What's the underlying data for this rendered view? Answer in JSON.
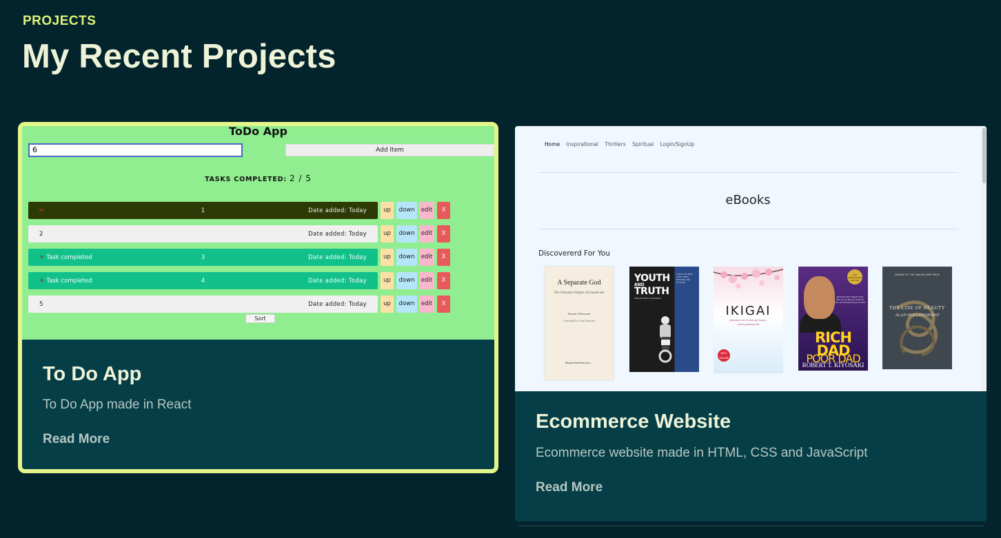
{
  "section": {
    "eyebrow": "PROJECTS",
    "title": "My Recent Projects"
  },
  "colors": {
    "background": "#03242c",
    "card": "#053e47",
    "accent": "#dff27a",
    "heading": "#eef3d8",
    "muted": "#b8c7c2"
  },
  "projects": [
    {
      "title": "To Do App",
      "description": "To Do App made in React",
      "link": "Read More",
      "selected": true,
      "preview": {
        "app_title": "ToDo App",
        "input_value": "6",
        "add_button": "Add Item",
        "tasks_completed_label": "TASKS COMPLETED:",
        "tasks_completed_count": "2 / 5",
        "rows": [
          {
            "lead": "",
            "number": "1",
            "date": "Date added: Today",
            "style": "dark"
          },
          {
            "lead": "2",
            "number": "",
            "date": "Date added: Today",
            "style": "light"
          },
          {
            "lead": "Task completed",
            "number": "3",
            "date": "Date added: Today",
            "style": "done"
          },
          {
            "lead": "Task completed",
            "number": "4",
            "date": "Date added: Today",
            "style": "done"
          },
          {
            "lead": "5",
            "number": "",
            "date": "Date added: Today",
            "style": "light"
          }
        ],
        "row_buttons": {
          "up": "up",
          "down": "down",
          "edit": "edit",
          "remove": "X"
        },
        "sort_button": "Sort"
      }
    },
    {
      "title": "Ecommerce Website",
      "description": "Ecommerce website made in HTML, CSS and JavaScript",
      "link": "Read More",
      "selected": false,
      "preview": {
        "nav": [
          "Home",
          "Inspirational",
          "Thrillers",
          "Spiritual",
          "Login/SignUp"
        ],
        "heading": "eBooks",
        "section_label": "Discovererd For You",
        "books": [
          {
            "cover_title": "A Separate God",
            "cover_subtitle": "The Christian Origins of Gnosticism",
            "cover_author": "Simone Pétrement",
            "cover_note": "Translated by Carol Harrison",
            "cover_publisher": "HarperSanFrancisco"
          },
          {
            "cover_title_1": "YOUTH",
            "cover_title_2": "AND",
            "cover_title_3": "TRUTH",
            "cover_tagline": "UNPLUG WITH SADHGURU",
            "cover_side": "FROM THE NEW YORK TIMES BESTSELLING AUTHOR"
          },
          {
            "cover_title": "IKIGAI",
            "cover_subtitle_1": "Japanese Art of staying Young..",
            "cover_subtitle_2": "while growing Old",
            "cover_badge": "BEST SELLER"
          },
          {
            "cover_title_1": "RICH",
            "cover_title_2": "DAD",
            "cover_title_3": "POOR DAD",
            "cover_author": "ROBERT T. KIYOSAKI",
            "cover_blurb": "What the Rich Teach Their Kids About Money That the Poor and Middle Class Do Not!",
            "cover_seal": "20th ANNIVERSARY EDITION"
          },
          {
            "cover_title": "THE LINE OF BEAUTY",
            "cover_author": "ALAN HOLLINGHURST",
            "cover_note": "WINNER OF THE MAN BOOKER PRIZE"
          }
        ]
      }
    }
  ]
}
